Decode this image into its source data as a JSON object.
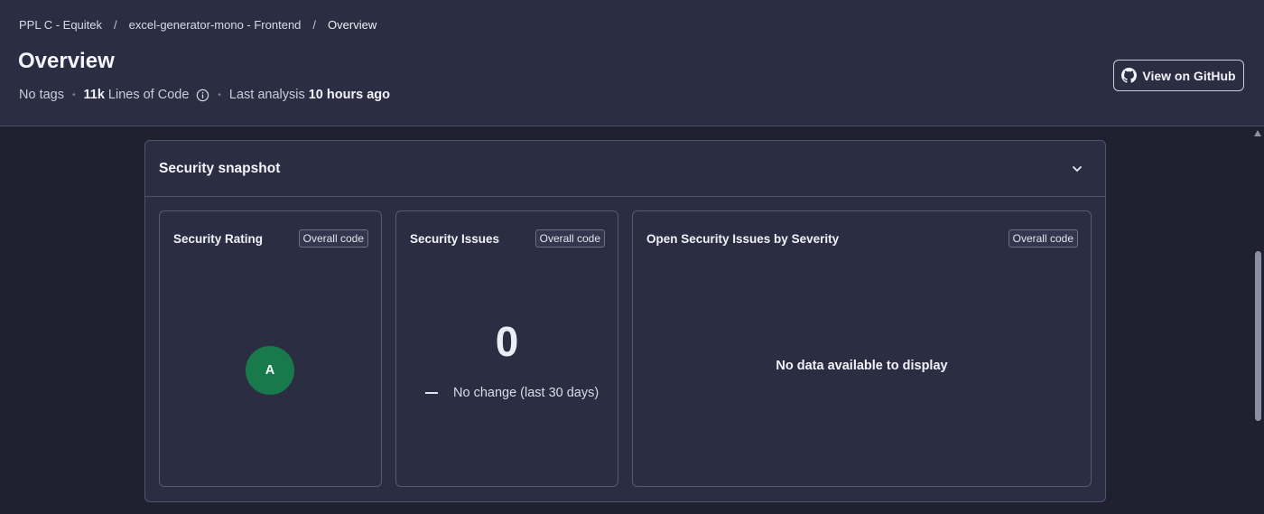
{
  "breadcrumb": {
    "items": [
      "PPL C - Equitek",
      "excel-generator-mono - Frontend",
      "Overview"
    ],
    "separator": "/"
  },
  "header": {
    "title": "Overview",
    "tags": "No tags",
    "loc_value": "11k",
    "loc_label": "Lines of Code",
    "analysis_label": "Last analysis",
    "analysis_value": "10 hours ago",
    "meta_dot": "•",
    "github_button": "View on GitHub"
  },
  "security_snapshot": {
    "title": "Security snapshot",
    "cards": {
      "rating": {
        "title": "Security Rating",
        "badge": "Overall code",
        "grade": "A",
        "grade_color": "#18794a"
      },
      "issues": {
        "title": "Security Issues",
        "badge": "Overall code",
        "count": "0",
        "change": "No change (last 30 days)"
      },
      "severity": {
        "title": "Open Security Issues by Severity",
        "badge": "Overall code",
        "empty_message": "No data available to display"
      }
    }
  },
  "icons": {
    "info": "info-icon",
    "github": "github-icon",
    "chevron": "chevron-down-icon"
  },
  "colors": {
    "background": "#1f2131",
    "surface": "#2b2e42",
    "border": "#4f5370",
    "rating_a": "#18794a"
  }
}
